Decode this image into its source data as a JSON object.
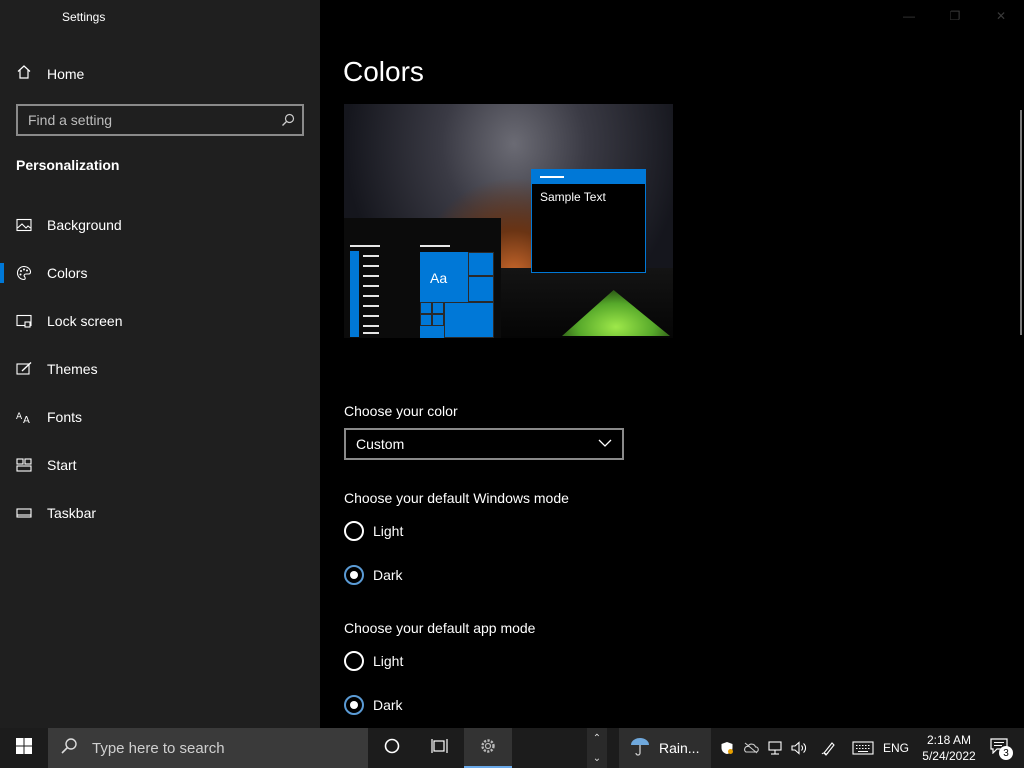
{
  "app": {
    "title": "Settings"
  },
  "sidebar": {
    "home_label": "Home",
    "search_placeholder": "Find a setting",
    "section_title": "Personalization",
    "items": [
      {
        "label": "Background",
        "icon": "picture-icon"
      },
      {
        "label": "Colors",
        "icon": "palette-icon",
        "selected": true
      },
      {
        "label": "Lock screen",
        "icon": "lock-screen-icon"
      },
      {
        "label": "Themes",
        "icon": "brush-icon"
      },
      {
        "label": "Fonts",
        "icon": "fonts-icon"
      },
      {
        "label": "Start",
        "icon": "start-icon"
      },
      {
        "label": "Taskbar",
        "icon": "taskbar-icon"
      }
    ]
  },
  "main": {
    "title": "Colors",
    "preview": {
      "sample_text": "Sample Text",
      "tile_text": "Aa"
    },
    "choose_color": {
      "label": "Choose your color",
      "value": "Custom"
    },
    "windows_mode": {
      "label": "Choose your default Windows mode",
      "options": [
        {
          "label": "Light",
          "checked": false
        },
        {
          "label": "Dark",
          "checked": true
        }
      ]
    },
    "app_mode": {
      "label": "Choose your default app mode",
      "options": [
        {
          "label": "Light",
          "checked": false
        },
        {
          "label": "Dark",
          "checked": true
        }
      ]
    }
  },
  "taskbar": {
    "search_placeholder": "Type here to search",
    "weather_label": "Rain...",
    "language": "ENG",
    "time": "2:18 AM",
    "date": "5/24/2022",
    "notification_count": "3"
  },
  "colors": {
    "accent": "#0078d7",
    "sidebar_bg": "#1f1f1f",
    "main_bg": "#000000",
    "taskbar_bg": "#1c1c1c"
  }
}
